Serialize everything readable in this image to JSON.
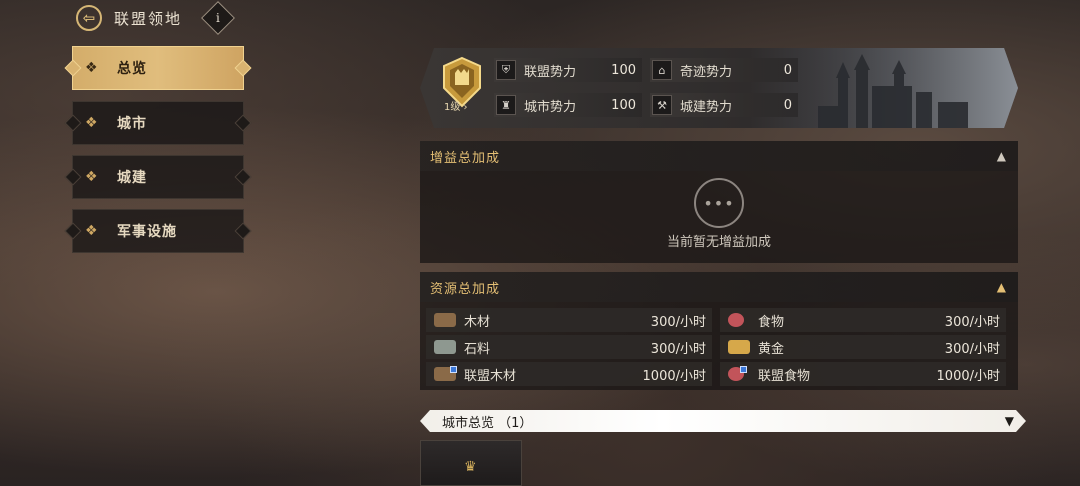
{
  "header": {
    "title": "联盟领地",
    "back_icon": "back-arrow-icon",
    "info_glyph": "i"
  },
  "sidebar": {
    "items": [
      {
        "label": "总览",
        "active": true
      },
      {
        "label": "城市",
        "active": false
      },
      {
        "label": "城建",
        "active": false
      },
      {
        "label": "军事设施",
        "active": false
      }
    ]
  },
  "banner": {
    "level": "1级",
    "stats": [
      {
        "label": "联盟势力",
        "value": "100",
        "icon": "shield-icon"
      },
      {
        "label": "奇迹势力",
        "value": "0",
        "icon": "temple-icon"
      },
      {
        "label": "城市势力",
        "value": "100",
        "icon": "city-icon"
      },
      {
        "label": "城建势力",
        "value": "0",
        "icon": "hammer-icon"
      }
    ]
  },
  "buff_panel": {
    "title": "增益总加成",
    "empty_text": "当前暂无增益加成"
  },
  "resource_panel": {
    "title": "资源总加成",
    "rows": [
      {
        "name": "木材",
        "value": "300/小时",
        "color": "#8a6a48"
      },
      {
        "name": "食物",
        "value": "300/小时",
        "color": "#c2545a"
      },
      {
        "name": "石料",
        "value": "300/小时",
        "color": "#8e9890"
      },
      {
        "name": "黄金",
        "value": "300/小时",
        "color": "#d6a84a"
      },
      {
        "name": "联盟木材",
        "value": "1000/小时",
        "color": "#8a6a48"
      },
      {
        "name": "联盟食物",
        "value": "1000/小时",
        "color": "#c2545a"
      }
    ]
  },
  "city_overview": {
    "title": "城市总览 （1）"
  },
  "colors": {
    "accent_gold": "#e4bf74",
    "active_tab": "#d9b370"
  }
}
